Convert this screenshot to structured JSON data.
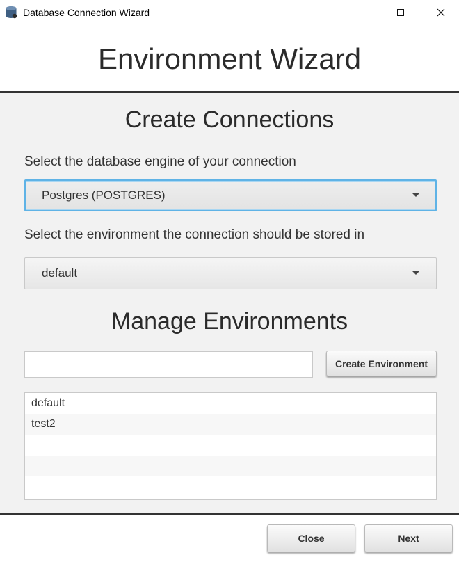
{
  "window": {
    "title": "Database Connection Wizard"
  },
  "header": {
    "title": "Environment Wizard"
  },
  "create_connections": {
    "title": "Create Connections",
    "engine_label": "Select the database engine of your connection",
    "engine_value": "Postgres (POSTGRES)",
    "environment_label": "Select the environment the connection should be stored in",
    "environment_value": "default"
  },
  "manage_environments": {
    "title": "Manage Environments",
    "input_value": "",
    "create_button": "Create Environment",
    "environments": [
      "default",
      "test2",
      "",
      "",
      ""
    ]
  },
  "footer": {
    "close_button": "Close",
    "next_button": "Next"
  },
  "colors": {
    "focus": "#5fb3e6",
    "divider": "#333333",
    "content_bg": "#f2f2f2"
  },
  "icons": [
    "database-icon",
    "minimize-icon",
    "maximize-icon",
    "close-icon",
    "dropdown-arrow-icon"
  ]
}
